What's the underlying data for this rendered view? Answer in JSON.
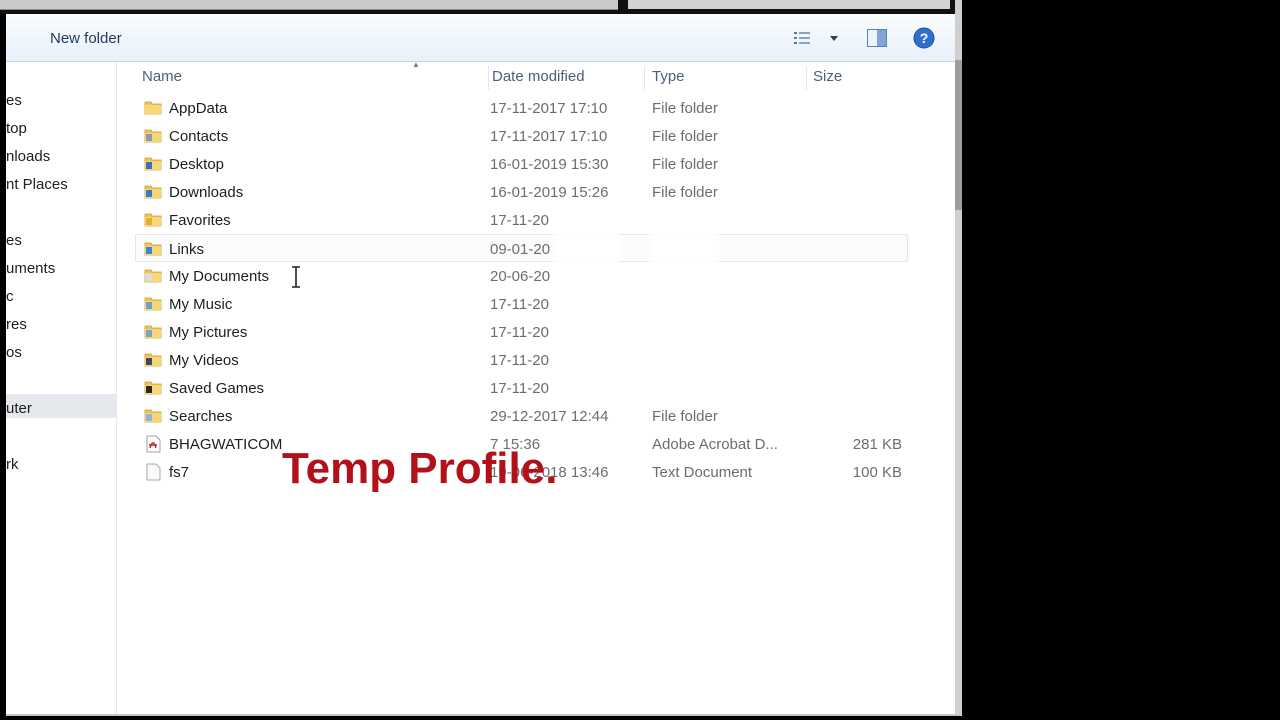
{
  "toolbar": {
    "new_folder_label": "New folder"
  },
  "nav": {
    "items": [
      "es",
      "top",
      "nloads",
      "nt Places",
      "es",
      "uments",
      "c",
      "res",
      "os",
      "uter",
      "rk"
    ],
    "selected_index": 9
  },
  "columns": {
    "name": "Name",
    "date": "Date modified",
    "type": "Type",
    "size": "Size"
  },
  "files": [
    {
      "name": "AppData",
      "date": "17-11-2017 17:10",
      "type": "File folder",
      "size": "",
      "icon": "folder-icon"
    },
    {
      "name": "Contacts",
      "date": "17-11-2017 17:10",
      "type": "File folder",
      "size": "",
      "icon": "contacts-folder-icon"
    },
    {
      "name": "Desktop",
      "date": "16-01-2019 15:30",
      "type": "File folder",
      "size": "",
      "icon": "desktop-folder-icon"
    },
    {
      "name": "Downloads",
      "date": "16-01-2019 15:26",
      "type": "File folder",
      "size": "",
      "icon": "downloads-folder-icon"
    },
    {
      "name": "Favorites",
      "date": "17-11-20",
      "type": "",
      "size": "",
      "icon": "favorites-folder-icon"
    },
    {
      "name": "Links",
      "date": "09-01-20",
      "type": "",
      "size": "",
      "icon": "links-folder-icon"
    },
    {
      "name": "My Documents",
      "date": "20-06-20",
      "type": "",
      "size": "",
      "icon": "documents-folder-icon"
    },
    {
      "name": "My Music",
      "date": "17-11-20",
      "type": "",
      "size": "",
      "icon": "music-folder-icon"
    },
    {
      "name": "My Pictures",
      "date": "17-11-20",
      "type": "",
      "size": "",
      "icon": "pictures-folder-icon"
    },
    {
      "name": "My Videos",
      "date": "17-11-20",
      "type": "",
      "size": "",
      "icon": "videos-folder-icon"
    },
    {
      "name": "Saved Games",
      "date": "17-11-20",
      "type": "",
      "size": "",
      "icon": "saved-games-folder-icon"
    },
    {
      "name": "Searches",
      "date": "29-12-2017 12:44",
      "type": "File folder",
      "size": "",
      "icon": "searches-folder-icon"
    },
    {
      "name": "BHAGWATICOM",
      "date": "7 15:36",
      "type": "Adobe Acrobat D...",
      "size": "281 KB",
      "icon": "pdf-file-icon"
    },
    {
      "name": "fs7",
      "date": "19-06-2018 13:46",
      "type": "Text Document",
      "size": "100 KB",
      "icon": "text-file-icon"
    }
  ],
  "hover_row_index": 5,
  "overlay_caption": "Temp Profile.",
  "colors": {
    "folder": "#f2c558",
    "overlay": "#b3111a",
    "help": "#2f6fd0"
  }
}
